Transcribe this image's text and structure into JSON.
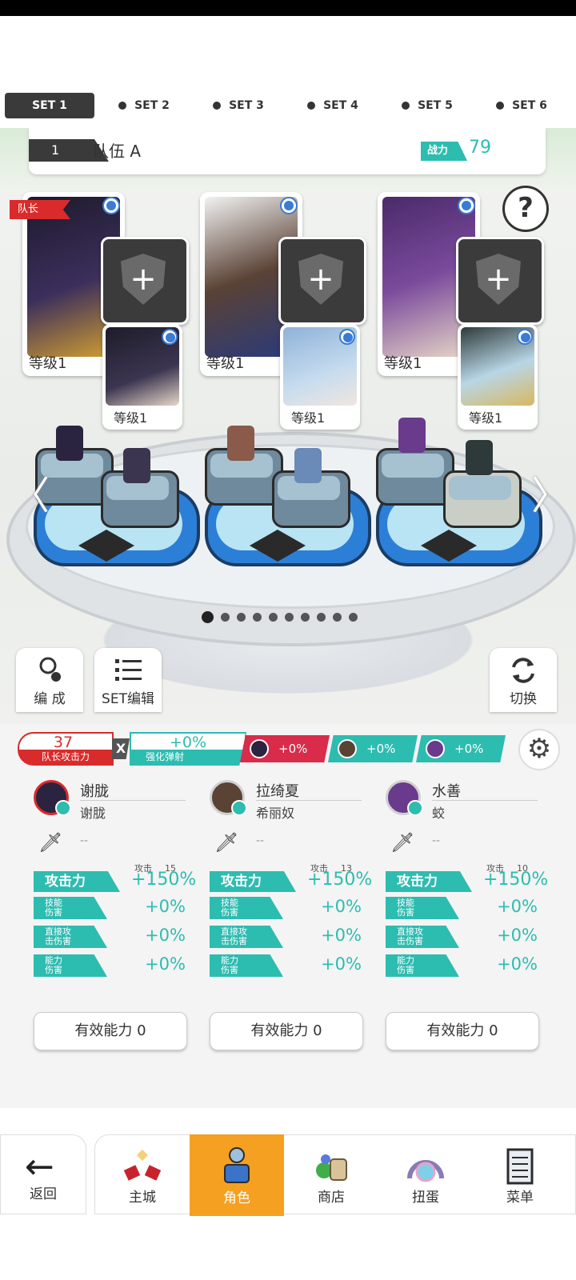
{
  "set_tabs": [
    "SET 1",
    "SET 2",
    "SET 3",
    "SET 4",
    "SET 5",
    "SET 6"
  ],
  "team": {
    "number": "1",
    "name": "队伍 A",
    "power_label": "战力",
    "power_value": "79"
  },
  "help_label": "?",
  "cards": [
    {
      "level": "等级1",
      "sub_level": "等级1",
      "leader": "队长",
      "art": "#2a2440",
      "sub_art": "#3b3550"
    },
    {
      "level": "等级1",
      "sub_level": "等级1",
      "art": "#5a4235",
      "sub_art": "#8fb2d8"
    },
    {
      "level": "等级1",
      "sub_level": "等级1",
      "art": "#6a3a8c",
      "sub_art": "#b8d6e6"
    }
  ],
  "arrows": {
    "left": "〈",
    "right": "〉"
  },
  "pager": {
    "total": 10,
    "active": 0
  },
  "buttons": {
    "compose": "编 成",
    "set_edit": "SET编辑",
    "switch": "切换"
  },
  "bonus": {
    "leader_attack_value": "37",
    "leader_attack_label": "队长攻击力",
    "multiply": "X",
    "enhance_value": "+0%",
    "enhance_label": "强化弹射",
    "hero_bonus": [
      "+0%",
      "+0%",
      "+0%"
    ]
  },
  "heroes": [
    {
      "name": "谢胧",
      "sub": "谢胧",
      "equip": "--",
      "atk_label": "攻击力",
      "atk_small_label": "攻击",
      "atk_small_value": "15",
      "atk_value": "+150%",
      "stats": [
        {
          "label": "技能\n伤害",
          "value": "+0%"
        },
        {
          "label": "直接攻\n击伤害",
          "value": "+0%"
        },
        {
          "label": "能力\n伤害",
          "value": "+0%"
        }
      ],
      "effective": "有效能力 0",
      "avatar_color": "#2a2440"
    },
    {
      "name": "拉绮夏",
      "sub": "希丽奴",
      "equip": "--",
      "atk_label": "攻击力",
      "atk_small_label": "攻击",
      "atk_small_value": "13",
      "atk_value": "+150%",
      "stats": [
        {
          "label": "技能\n伤害",
          "value": "+0%"
        },
        {
          "label": "直接攻\n击伤害",
          "value": "+0%"
        },
        {
          "label": "能力\n伤害",
          "value": "+0%"
        }
      ],
      "effective": "有效能力 0",
      "avatar_color": "#5a4235"
    },
    {
      "name": "水善",
      "sub": "蛟",
      "equip": "--",
      "atk_label": "攻击力",
      "atk_small_label": "攻击",
      "atk_small_value": "10",
      "atk_value": "+150%",
      "stats": [
        {
          "label": "技能\n伤害",
          "value": "+0%"
        },
        {
          "label": "直接攻\n击伤害",
          "value": "+0%"
        },
        {
          "label": "能力\n伤害",
          "value": "+0%"
        }
      ],
      "effective": "有效能力 0",
      "avatar_color": "#6a3a8c"
    }
  ],
  "nav": {
    "back": "返回",
    "items": [
      "主城",
      "角色",
      "商店",
      "扭蛋",
      "菜单"
    ],
    "active": 1
  },
  "colors": {
    "accent": "#2dbcb0",
    "leader_red": "#d92b2b",
    "nav_active": "#f5a020"
  }
}
